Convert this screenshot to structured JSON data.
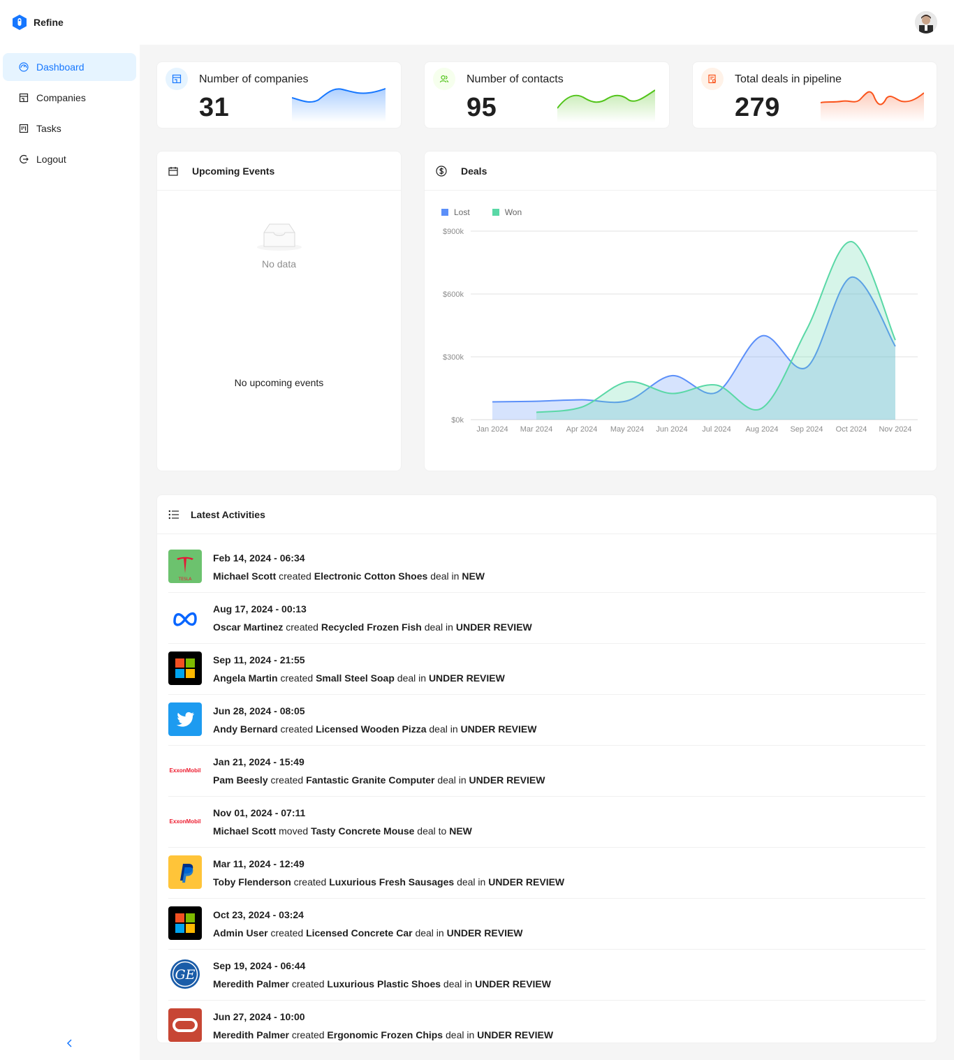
{
  "app": {
    "name": "Refine"
  },
  "sidebar": {
    "items": [
      {
        "label": "Dashboard",
        "icon": "dashboard-icon",
        "active": true
      },
      {
        "label": "Companies",
        "icon": "shop-icon",
        "active": false
      },
      {
        "label": "Tasks",
        "icon": "project-board-icon",
        "active": false
      },
      {
        "label": "Logout",
        "icon": "logout-icon",
        "active": false
      }
    ]
  },
  "kpis": [
    {
      "title": "Number of companies",
      "value": "31",
      "color": "#1677ff",
      "bg": "#e6f4ff",
      "icon": "shop-icon"
    },
    {
      "title": "Number of contacts",
      "value": "95",
      "color": "#52c41a",
      "bg": "#f6ffed",
      "icon": "team-icon"
    },
    {
      "title": "Total deals in pipeline",
      "value": "279",
      "color": "#fa541c",
      "bg": "#fff2e8",
      "icon": "audit-icon"
    }
  ],
  "events": {
    "title": "Upcoming Events",
    "empty_label": "No data",
    "no_events": "No upcoming events"
  },
  "deals": {
    "title": "Deals",
    "legend": [
      {
        "name": "Lost",
        "color": "#5b8ff9"
      },
      {
        "name": "Won",
        "color": "#5ad8a6"
      }
    ]
  },
  "chart_data": {
    "type": "area",
    "title": "Deals",
    "x": [
      "Jan 2024",
      "Mar 2024",
      "Apr 2024",
      "May 2024",
      "Jun 2024",
      "Jul 2024",
      "Aug 2024",
      "Sep 2024",
      "Oct 2024",
      "Nov 2024"
    ],
    "y_ticks": [
      "$0k",
      "$300k",
      "$600k",
      "$900k"
    ],
    "ylim": [
      0,
      900
    ],
    "grid": true,
    "legend_position": "top-left",
    "series": [
      {
        "name": "Lost",
        "color": "#5b8ff9",
        "values": [
          85,
          88,
          95,
          90,
          210,
          130,
          400,
          250,
          680,
          350
        ]
      },
      {
        "name": "Won",
        "color": "#5ad8a6",
        "values": [
          null,
          35,
          60,
          180,
          125,
          165,
          55,
          430,
          850,
          380
        ]
      }
    ]
  },
  "activities": {
    "title": "Latest Activities",
    "connector_created": "created",
    "connector_moved": "moved",
    "deal_in": "deal in",
    "deal_to": "deal to",
    "items": [
      {
        "date": "Feb 14, 2024 - 06:34",
        "user": "Michael Scott",
        "verb": "created",
        "deal": "Electronic Cotton Shoes",
        "prep": "deal in",
        "stage": "NEW",
        "logo": "tesla"
      },
      {
        "date": "Aug 17, 2024 - 00:13",
        "user": "Oscar Martinez",
        "verb": "created",
        "deal": "Recycled Frozen Fish",
        "prep": "deal in",
        "stage": "UNDER REVIEW",
        "logo": "meta"
      },
      {
        "date": "Sep 11, 2024 - 21:55",
        "user": "Angela Martin",
        "verb": "created",
        "deal": "Small Steel Soap",
        "prep": "deal in",
        "stage": "UNDER REVIEW",
        "logo": "microsoft"
      },
      {
        "date": "Jun 28, 2024 - 08:05",
        "user": "Andy Bernard",
        "verb": "created",
        "deal": "Licensed Wooden Pizza",
        "prep": "deal in",
        "stage": "UNDER REVIEW",
        "logo": "twitter"
      },
      {
        "date": "Jan 21, 2024 - 15:49",
        "user": "Pam Beesly",
        "verb": "created",
        "deal": "Fantastic Granite Computer",
        "prep": "deal in",
        "stage": "UNDER REVIEW",
        "logo": "exxonmobil"
      },
      {
        "date": "Nov 01, 2024 - 07:11",
        "user": "Michael Scott",
        "verb": "moved",
        "deal": "Tasty Concrete Mouse",
        "prep": "deal to",
        "stage": "NEW",
        "logo": "exxonmobil"
      },
      {
        "date": "Mar 11, 2024 - 12:49",
        "user": "Toby Flenderson",
        "verb": "created",
        "deal": "Luxurious Fresh Sausages",
        "prep": "deal in",
        "stage": "UNDER REVIEW",
        "logo": "paypal"
      },
      {
        "date": "Oct 23, 2024 - 03:24",
        "user": "Admin User",
        "verb": "created",
        "deal": "Licensed Concrete Car",
        "prep": "deal in",
        "stage": "UNDER REVIEW",
        "logo": "microsoft"
      },
      {
        "date": "Sep 19, 2024 - 06:44",
        "user": "Meredith Palmer",
        "verb": "created",
        "deal": "Luxurious Plastic Shoes",
        "prep": "deal in",
        "stage": "UNDER REVIEW",
        "logo": "ge"
      },
      {
        "date": "Jun 27, 2024 - 10:00",
        "user": "Meredith Palmer",
        "verb": "created",
        "deal": "Ergonomic Frozen Chips",
        "prep": "deal in",
        "stage": "UNDER REVIEW",
        "logo": "oracle"
      }
    ],
    "logo_text": {
      "tesla": "TESLA",
      "exxonmobil": "ExxonMobil",
      "ge": "GE"
    }
  }
}
